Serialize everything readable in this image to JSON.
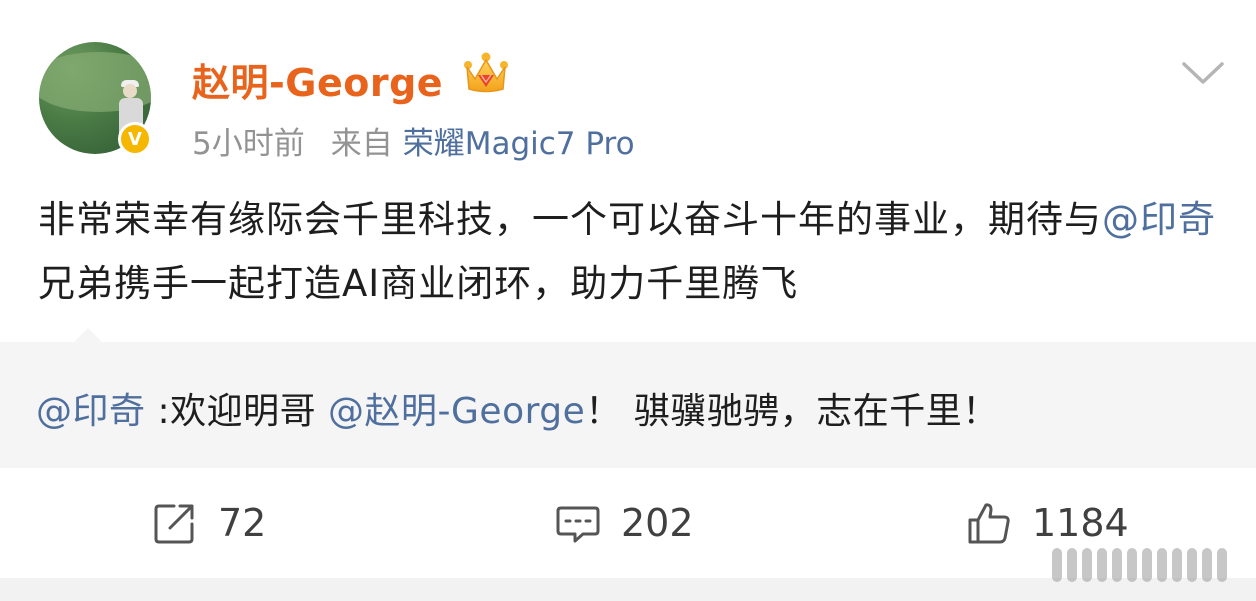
{
  "post": {
    "author": "赵明-George",
    "badge_letter": "V",
    "time": "5小时前",
    "from_label": "来自",
    "device": "荣耀Magic7 Pro",
    "content": {
      "part1": "非常荣幸有缘际会千里科技，一个可以奋斗十年的事业，期待与",
      "mention": "@印奇",
      "part2": " 兄弟携手一起打造AI商业闭环，助力千里腾飞"
    },
    "quote": {
      "mention1": "@印奇",
      "text1": " :欢迎明哥 ",
      "mention2": "@赵明-George",
      "text2": "！  骐骥驰骋，志在千里！"
    },
    "actions": {
      "share_count": "72",
      "comment_count": "202",
      "like_count": "1184"
    }
  },
  "colors": {
    "author_name": "#e8641c",
    "link": "#4f6f9e",
    "meta_gray": "#939393",
    "verify_badge": "#f6b700"
  },
  "icons": [
    "crown-icon",
    "verified-badge-icon",
    "chevron-down-icon",
    "share-icon",
    "comment-icon",
    "like-icon"
  ]
}
